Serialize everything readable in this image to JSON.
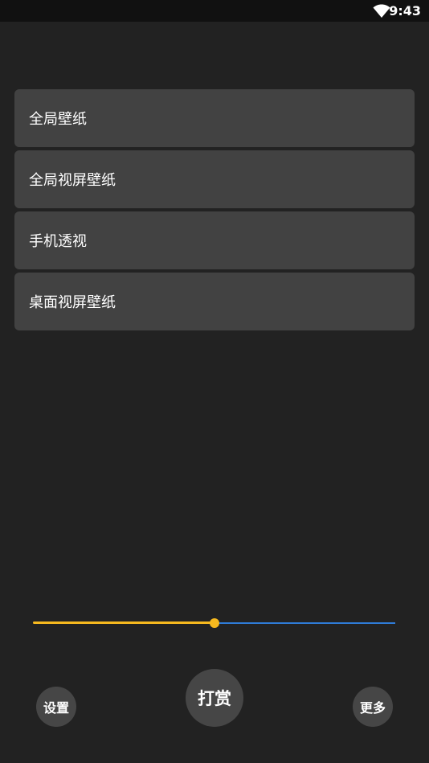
{
  "status_bar": {
    "time": "9:43",
    "wifi_icon": "wifi-icon"
  },
  "menu": {
    "items": [
      {
        "label": "全局壁纸"
      },
      {
        "label": "全局视屏壁纸"
      },
      {
        "label": "手机透视"
      },
      {
        "label": "桌面视屏壁纸"
      }
    ]
  },
  "slider": {
    "value_fraction": 0.5,
    "active_color": "#f6b91f",
    "inactive_color": "#2f7cd8"
  },
  "bottom_bar": {
    "settings_label": "设置",
    "reward_label": "打赏",
    "more_label": "更多"
  }
}
